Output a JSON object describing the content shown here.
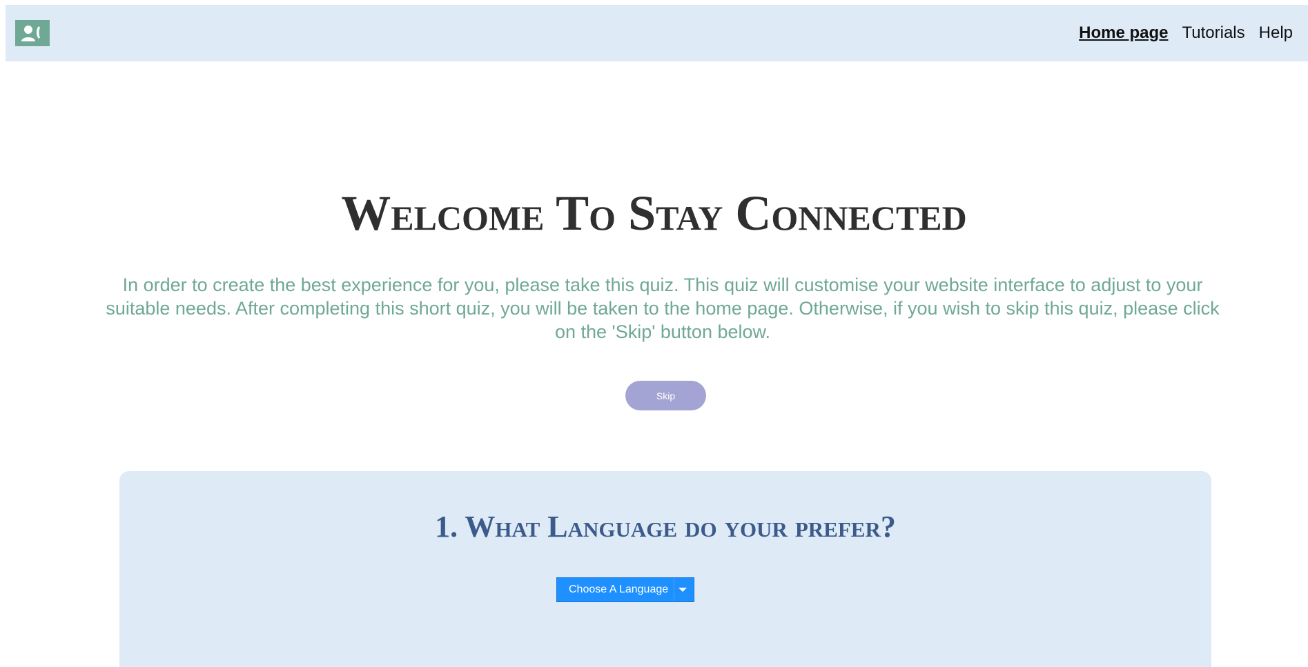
{
  "header": {
    "logo_icon": "contact-phone-icon",
    "nav": [
      {
        "label": "Home page",
        "active": true
      },
      {
        "label": "Tutorials",
        "active": false
      },
      {
        "label": "Help",
        "active": false
      }
    ]
  },
  "main": {
    "title": "Welcome To Stay Connected",
    "intro": "In order to create the best experience for you, please take this quiz. This quiz will customise your website interface to adjust to your suitable needs. After completing this short quiz, you will be taken to the home page. Otherwise, if you wish to skip this quiz, please click on the 'Skip' button below.",
    "skip_label": "Skip"
  },
  "quiz": {
    "question": "1. What Language do your prefer?",
    "select_label": "Choose A Language"
  },
  "colors": {
    "accent_green": "#6fa895",
    "nav_background": "#deebf7",
    "skip_button": "#a3a4d3",
    "select_button": "#1e90ff",
    "question_text": "#3c5a8a"
  }
}
